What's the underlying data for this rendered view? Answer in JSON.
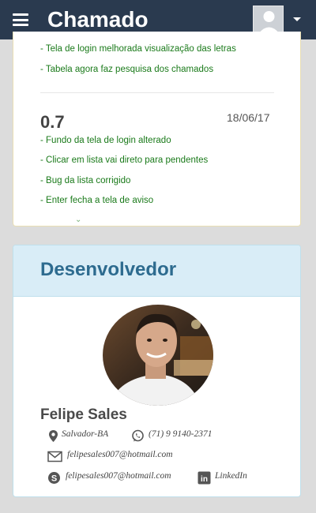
{
  "navbar": {
    "title": "Chamado",
    "menu_icon": "hamburger-menu-icon",
    "user_icon": "user-avatar-icon",
    "dropdown_icon": "caret-down-icon"
  },
  "changelog": {
    "previous_items": [
      "- Tela de login melhorada visualização das letras",
      "- Tabela agora faz pesquisa dos chamados"
    ],
    "version": "0.7",
    "date": "18/06/17",
    "items": [
      "- Fundo da tela de login alterado",
      "- Clicar em lista vai direto para pendentes",
      "- Bug da lista corrigido",
      "- Enter fecha a tela de aviso"
    ]
  },
  "developer": {
    "heading": "Desenvolvedor",
    "name": "Felipe Sales",
    "location": "Salvador-BA",
    "phone": "(71) 9 9140-2371",
    "email": "felipesales007@hotmail.com",
    "skype": "felipesales007@hotmail.com",
    "linkedin": "LinkedIn",
    "colors": {
      "header_bg": "#d9edf7",
      "heading": "#2d6b8f",
      "change_text": "#1a7a1a",
      "navbar": "#2a3a4f"
    }
  }
}
